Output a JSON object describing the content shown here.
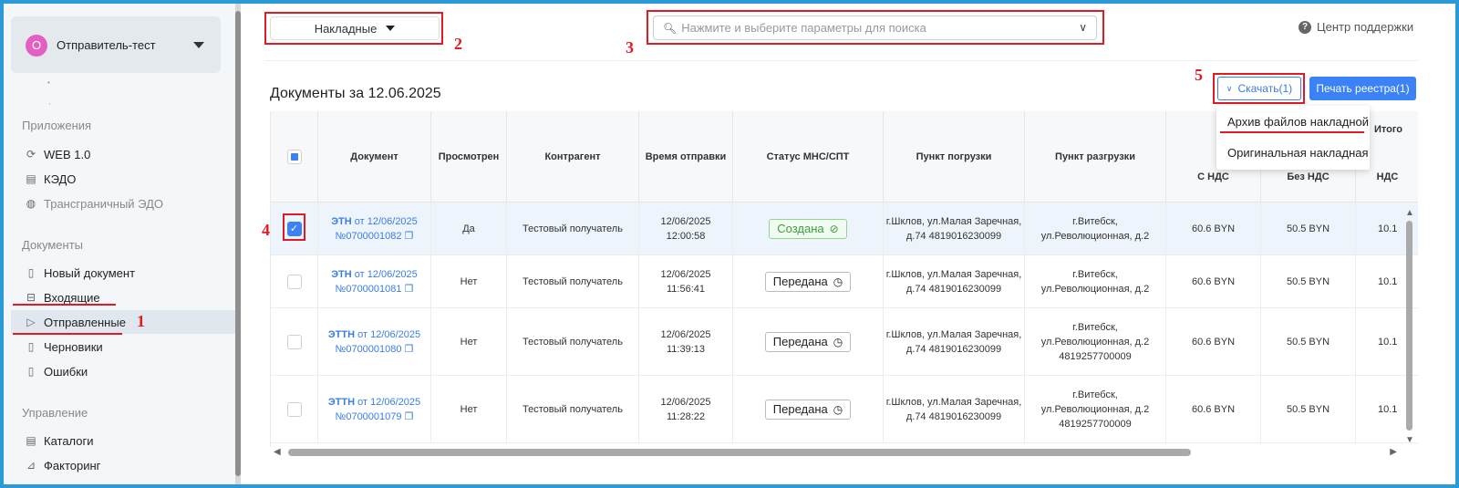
{
  "account": {
    "avatar_letter": "О",
    "name": "Отправитель-тест"
  },
  "sidebar": {
    "apps_title": "Приложения",
    "apps": [
      {
        "label": "WEB 1.0",
        "icon": "refresh-icon"
      },
      {
        "label": "КЭДО",
        "icon": "document-list-icon"
      },
      {
        "label": "Трансграничный ЭДО",
        "icon": "globe-icon"
      }
    ],
    "docs_title": "Документы",
    "docs": [
      {
        "label": "Новый документ",
        "icon": "file-icon"
      },
      {
        "label": "Входящие",
        "icon": "inbox-icon"
      },
      {
        "label": "Отправленные",
        "icon": "send-icon"
      },
      {
        "label": "Черновики",
        "icon": "file-icon"
      },
      {
        "label": "Ошибки",
        "icon": "file-icon"
      }
    ],
    "mgmt_title": "Управление",
    "mgmt": [
      {
        "label": "Каталоги",
        "icon": "catalog-icon"
      },
      {
        "label": "Факторинг",
        "icon": "chart-icon"
      }
    ]
  },
  "toolbar": {
    "doc_type": "Накладные",
    "search_placeholder": "Нажмите и выберите параметры для поиска",
    "help": "Центр поддержки"
  },
  "annotations": [
    "1",
    "2",
    "3",
    "4",
    "5"
  ],
  "page": {
    "title": "Документы за 12.06.2025",
    "download_btn": "Скачать(1)",
    "print_btn": "Печать реестра(1)"
  },
  "download_menu": [
    "Архив файлов накладной",
    "Оригинальная накладная"
  ],
  "table": {
    "headers": {
      "document": "Документ",
      "viewed": "Просмотрен",
      "counterparty": "Контрагент",
      "sent_time": "Время отправки",
      "status": "Статус МНС/СПТ",
      "loading": "Пункт погрузки",
      "unloading": "Пункт разгрузки",
      "with_vat": "С НДС",
      "without_vat": "Без НДС",
      "vat": "НДС",
      "total": "Итого"
    },
    "rows": [
      {
        "type": "ЭТН",
        "date": "от 12/06/2025",
        "number": "№0700001082",
        "viewed": "Да",
        "counterparty": "Тестовый получатель",
        "date_sent": "12/06/2025",
        "time_sent": "12:00:58",
        "status": "Создана",
        "status_kind": "ok",
        "loading1": "г.Шклов, ул.Малая Заречная,",
        "loading2": "д.74 4819016230099",
        "unload1": "г.Витебск,",
        "unload2": "ул.Революционная, д.2",
        "unload3": "",
        "with_vat": "60.6 BYN",
        "without_vat": "50.5 BYN",
        "vat": "10.1",
        "checked": true
      },
      {
        "type": "ЭТН",
        "date": "от 12/06/2025",
        "number": "№0700001081",
        "viewed": "Нет",
        "counterparty": "Тестовый получатель",
        "date_sent": "12/06/2025",
        "time_sent": "11:56:41",
        "status": "Передана",
        "status_kind": "sent",
        "loading1": "г.Шклов, ул.Малая Заречная,",
        "loading2": "д.74 4819016230099",
        "unload1": "г.Витебск,",
        "unload2": "ул.Революционная, д.2",
        "unload3": "",
        "with_vat": "60.6 BYN",
        "without_vat": "50.5 BYN",
        "vat": "10.1",
        "checked": false
      },
      {
        "type": "ЭТТН",
        "date": "от 12/06/2025",
        "number": "№0700001080",
        "viewed": "Нет",
        "counterparty": "Тестовый получатель",
        "date_sent": "12/06/2025",
        "time_sent": "11:39:13",
        "status": "Передана",
        "status_kind": "sent",
        "loading1": "г.Шклов, ул.Малая Заречная,",
        "loading2": "д.74 4819016230099",
        "unload1": "г.Витебск,",
        "unload2": "ул.Революционная, д.2",
        "unload3": "4819257700009",
        "with_vat": "60.6 BYN",
        "without_vat": "50.5 BYN",
        "vat": "10.1",
        "checked": false
      },
      {
        "type": "ЭТТН",
        "date": "от 12/06/2025",
        "number": "№0700001079",
        "viewed": "Нет",
        "counterparty": "Тестовый получатель",
        "date_sent": "12/06/2025",
        "time_sent": "11:28:22",
        "status": "Передана",
        "status_kind": "sent",
        "loading1": "г.Шклов, ул.Малая Заречная,",
        "loading2": "д.74 4819016230099",
        "unload1": "г.Витебск,",
        "unload2": "ул.Революционная, д.2",
        "unload3": "4819257700009",
        "with_vat": "60.6 BYN",
        "without_vat": "50.5 BYN",
        "vat": "10.1",
        "checked": false
      }
    ]
  }
}
